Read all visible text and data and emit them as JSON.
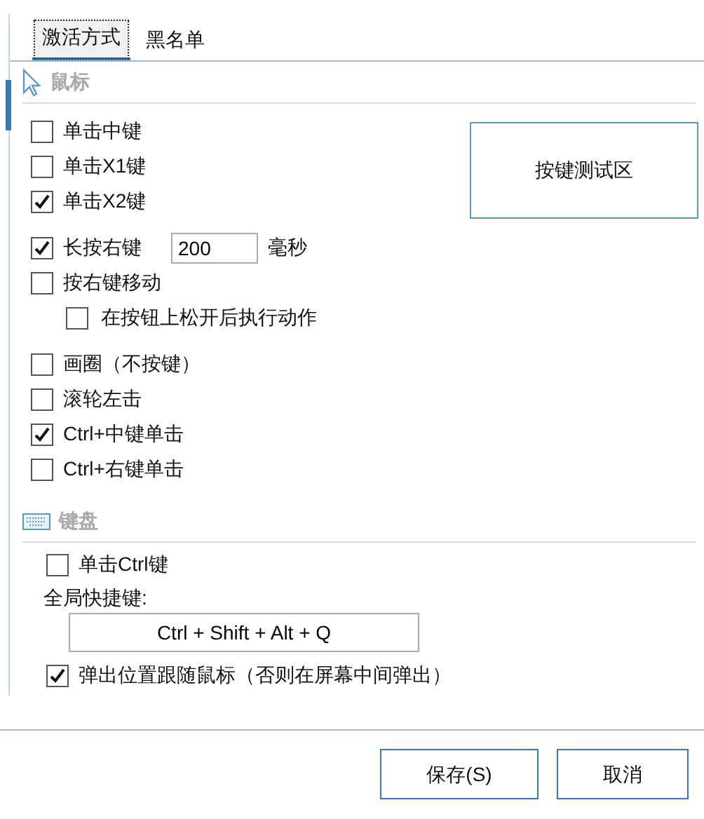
{
  "tabs": [
    {
      "label": "激活方式",
      "selected": true
    },
    {
      "label": "黑名单",
      "selected": false
    }
  ],
  "mouse": {
    "title": "鼠标",
    "test_area": "按键测试区",
    "options": [
      {
        "kind": "checkbox",
        "label": "单击中键",
        "checked": false
      },
      {
        "kind": "checkbox",
        "label": "单击X1键",
        "checked": false
      },
      {
        "kind": "checkbox",
        "label": "单击X2键",
        "checked": true
      },
      {
        "kind": "spacer"
      },
      {
        "kind": "duration",
        "label": "长按右键",
        "checked": true,
        "value": "200",
        "unit": "毫秒"
      },
      {
        "kind": "checkbox",
        "label": "按右键移动",
        "checked": false
      },
      {
        "kind": "subcheckbox",
        "label": "在按钮上松开后执行动作",
        "checked": false
      },
      {
        "kind": "spacer"
      },
      {
        "kind": "checkbox",
        "label": "画圈（不按键）",
        "checked": false
      },
      {
        "kind": "checkbox",
        "label": "滚轮左击",
        "checked": false
      },
      {
        "kind": "checkbox",
        "label": "Ctrl+中键单击",
        "checked": true
      },
      {
        "kind": "checkbox",
        "label": "Ctrl+右键单击",
        "checked": false
      }
    ]
  },
  "keyboard": {
    "title": "键盘",
    "ctrl_option": {
      "label": "单击Ctrl键",
      "checked": false
    },
    "hotkey_label": "全局快捷键:",
    "hotkey": "Ctrl + Shift + Alt + Q",
    "follow_option": {
      "label": "弹出位置跟随鼠标（否则在屏幕中间弹出）",
      "checked": true
    }
  },
  "buttons": [
    {
      "label": "保存(S)"
    },
    {
      "label": "取消"
    }
  ]
}
